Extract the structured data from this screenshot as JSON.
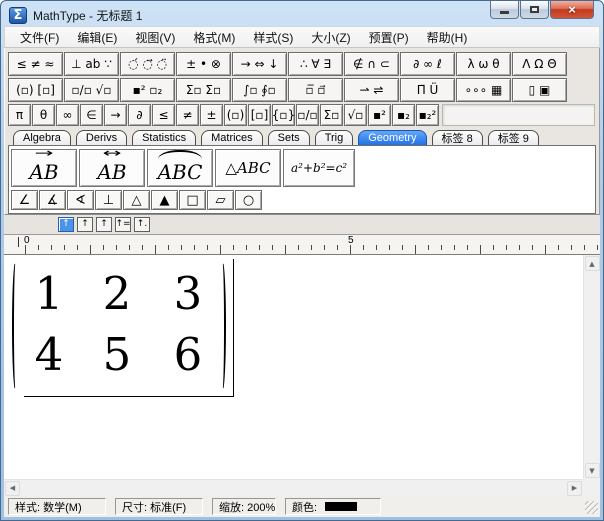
{
  "window": {
    "title": "MathType - 无标题 1",
    "icon_glyph": "Σ"
  },
  "icons": {
    "close": "×",
    "scroll_up": "▲",
    "scroll_down": "▼",
    "scroll_left": "◀",
    "scroll_right": "▶"
  },
  "menu": {
    "items": [
      "文件(F)",
      "编辑(E)",
      "视图(V)",
      "格式(M)",
      "样式(S)",
      "大小(Z)",
      "预置(P)",
      "帮助(H)"
    ]
  },
  "palette": {
    "row1": [
      "≤ ≠ ≈",
      "⊥ ab ∵",
      "◌́ ◌⃗ ◌̈",
      "± • ⊗",
      "→ ⇔ ↓",
      "∴ ∀ ∃",
      "∉ ∩ ⊂",
      "∂ ∞ ℓ",
      "λ ω θ",
      "Λ Ω Θ"
    ],
    "row2": [
      "(▫) [▫]",
      "▫/▫ √▫",
      "▪² ▫₂",
      "Σ▫ Σ▫",
      "∫▫ ∮▫",
      "▫̅ ▫⃗",
      "⇀ ⇌",
      "Π̈ Ü",
      "∘∘∘ ▦",
      "▯ ▣"
    ],
    "row3": [
      "π",
      "θ",
      "∞",
      "∈",
      "→",
      "∂",
      "≤",
      "≠",
      "±",
      "(▫)",
      "[▫]",
      "{▫}",
      "▫/▫",
      "Σ▫",
      "√▫",
      "▪²",
      "▪₂",
      "▪₂²"
    ]
  },
  "tabs": [
    "Algebra",
    "Derivs",
    "Statistics",
    "Matrices",
    "Sets",
    "Trig",
    "Geometry",
    "标签 8",
    "标签 9"
  ],
  "geometry": {
    "big": [
      {
        "base": "AB",
        "over": "→"
      },
      {
        "base": "AB",
        "over": "↔"
      },
      {
        "base": "ABC"
      },
      {
        "mark": "△",
        "label": "ABC"
      },
      {
        "label": "a²+b²=c²"
      }
    ],
    "small": [
      "∠",
      "∡",
      "∢",
      "⊥",
      "△",
      "▲",
      "□",
      "▱",
      "○"
    ]
  },
  "tabstops": [
    "↑",
    "↑",
    "↑",
    "↑=",
    "↑."
  ],
  "ruler": {
    "zero": "0",
    "five": "5"
  },
  "editor": {
    "matrix": {
      "rows": [
        [
          "1",
          "2",
          "3"
        ],
        [
          "4",
          "5",
          "6"
        ]
      ]
    }
  },
  "status": {
    "style": "样式: 数学(M)",
    "size": "尺寸: 标准(F)",
    "zoom": "缩放: 200%",
    "color": "颜色:"
  }
}
